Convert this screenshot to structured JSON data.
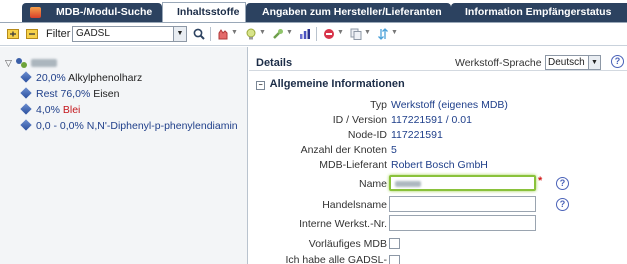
{
  "tabs": [
    {
      "label": "MDB-/Modul-Suche",
      "active": false
    },
    {
      "label": "Inhaltsstoffe",
      "active": true
    },
    {
      "label": "Angaben zum Hersteller/Lieferanten",
      "active": false
    },
    {
      "label": "Information Empfängerstatus",
      "active": false
    }
  ],
  "toolbar": {
    "filter_label": "Filter",
    "filter_value": "GADSL",
    "icons": [
      "expand-all-icon",
      "collapse-all-icon",
      "search-icon",
      "gloves-icon",
      "bulb-icon",
      "wrench-icon",
      "chart-icon",
      "stop-icon",
      "copy-icon",
      "sort-icon"
    ]
  },
  "tree": {
    "root_label_redacted": true,
    "items": [
      {
        "percent": "20,0%",
        "name": "Alkylphenolharz",
        "style": "normal"
      },
      {
        "percent": "Rest 76,0%",
        "name": "Eisen",
        "style": "normal"
      },
      {
        "percent": "4,0%",
        "name": "Blei",
        "style": "red"
      },
      {
        "percent": "0,0 - 0,0%",
        "name": "N,N'-Diphenyl-p-phenylendiamin",
        "style": "blue"
      }
    ]
  },
  "details": {
    "title": "Details",
    "language_label": "Werkstoff-Sprache",
    "language_value": "Deutsch",
    "section_title": "Allgemeine Informationen",
    "fields": [
      {
        "label": "Typ",
        "value": "Werkstoff (eigenes MDB)"
      },
      {
        "label": "ID / Version",
        "value": "117221591 / 0.01"
      },
      {
        "label": "Node-ID",
        "value": "117221591"
      },
      {
        "label": "Anzahl der Knoten",
        "value": "5"
      },
      {
        "label": "MDB-Lieferant",
        "value": "Robert Bosch GmbH"
      }
    ],
    "name_label": "Name",
    "handelsname_label": "Handelsname",
    "interne_label": "Interne Werkst.-Nr.",
    "vorlaeufiges_label": "Vorläufiges MDB",
    "gadsl_label": "Ich habe alle GADSL-"
  },
  "colors": {
    "tab_bg": "#2c4260",
    "focus_border": "#8ac23b",
    "link_blue": "#1f3f8a",
    "red": "#c4161c"
  }
}
